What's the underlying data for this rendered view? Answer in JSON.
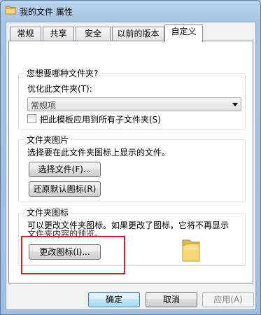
{
  "window": {
    "title": "我的文件 属性"
  },
  "tabs": [
    {
      "label": "常规"
    },
    {
      "label": "共享"
    },
    {
      "label": "安全"
    },
    {
      "label": "以前的版本"
    },
    {
      "label": "自定义"
    }
  ],
  "optimize_group": {
    "title": "您想要哪种文件夹?",
    "optimize_label": "优化此文件夹(T):",
    "optimize_value": "常规项",
    "apply_subfolders_label": "把此模板应用到所有子文件夹(S)",
    "apply_subfolders_checked": false
  },
  "picture_group": {
    "title": "文件夹图片",
    "description": "选择要在此文件夹图标上显示的文件。",
    "choose_file_label": "选择文件(F)...",
    "restore_default_label": "还原默认图标(R)"
  },
  "icon_group": {
    "title": "文件夹图标",
    "description_line1": "可以更改文件夹图标。如果更改了图标，它将不再显示",
    "description_line2": "文件夹内容的预览。",
    "change_icon_label": "更改图标(I)...",
    "folder_icon": "folder-icon"
  },
  "footer": {
    "ok_label": "确定",
    "cancel_label": "取消",
    "apply_label": "应用(A)"
  },
  "colors": {
    "highlight": "#e31b1b",
    "window_frame": "#a0bfe0"
  }
}
